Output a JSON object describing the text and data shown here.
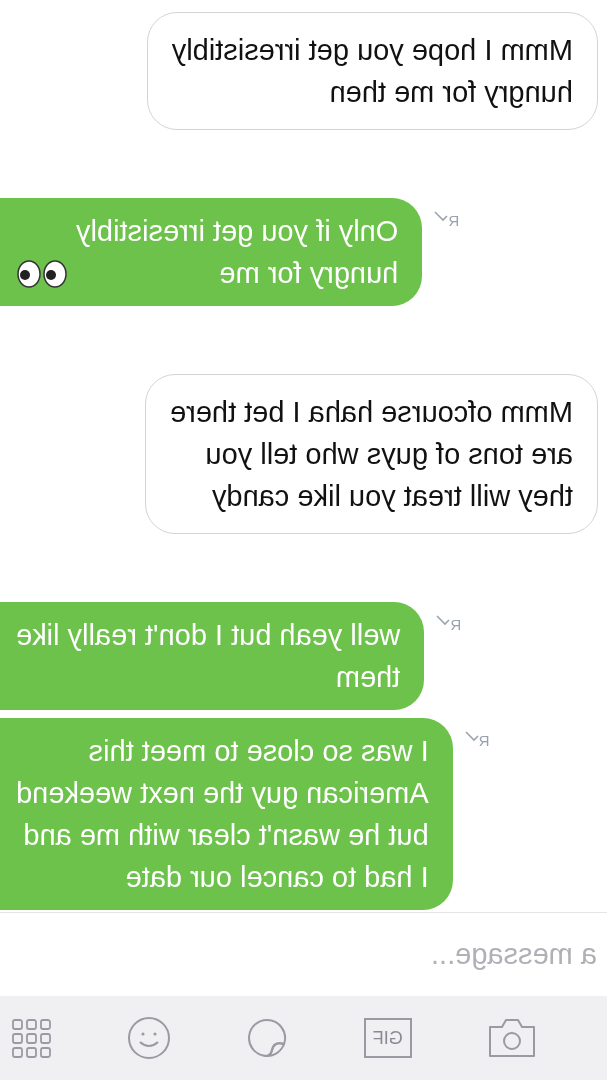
{
  "mirrored": true,
  "messages": [
    {
      "kind": "in",
      "lines": [
        "Mmm I hope you get irresistibly",
        "hungry for me then"
      ]
    },
    {
      "kind": "out",
      "lines": [
        "Only if you get irresistibly",
        "hungry for me"
      ],
      "eyes": true,
      "receipt": "R"
    },
    {
      "kind": "in",
      "lines": [
        "Mmm ofcourse haha I bet there",
        "are tons of guys who tell you",
        "they will treat you like candy"
      ]
    },
    {
      "kind": "out",
      "lines": [
        "well yeah but I don't really like",
        "them"
      ],
      "receipt": "R"
    },
    {
      "kind": "out",
      "lines": [
        "I was so close to meet this",
        "American guy the next weekend",
        "but he wasn't clear with me and",
        "I had to cancel our date"
      ],
      "receipt": "R"
    }
  ],
  "composer": {
    "placeholder": "a message..."
  },
  "toolbar": [
    {
      "kind": "camera"
    },
    {
      "kind": "gif",
      "label": "GIF"
    },
    {
      "kind": "sticker"
    },
    {
      "kind": "emoji"
    },
    {
      "kind": "grid"
    }
  ]
}
